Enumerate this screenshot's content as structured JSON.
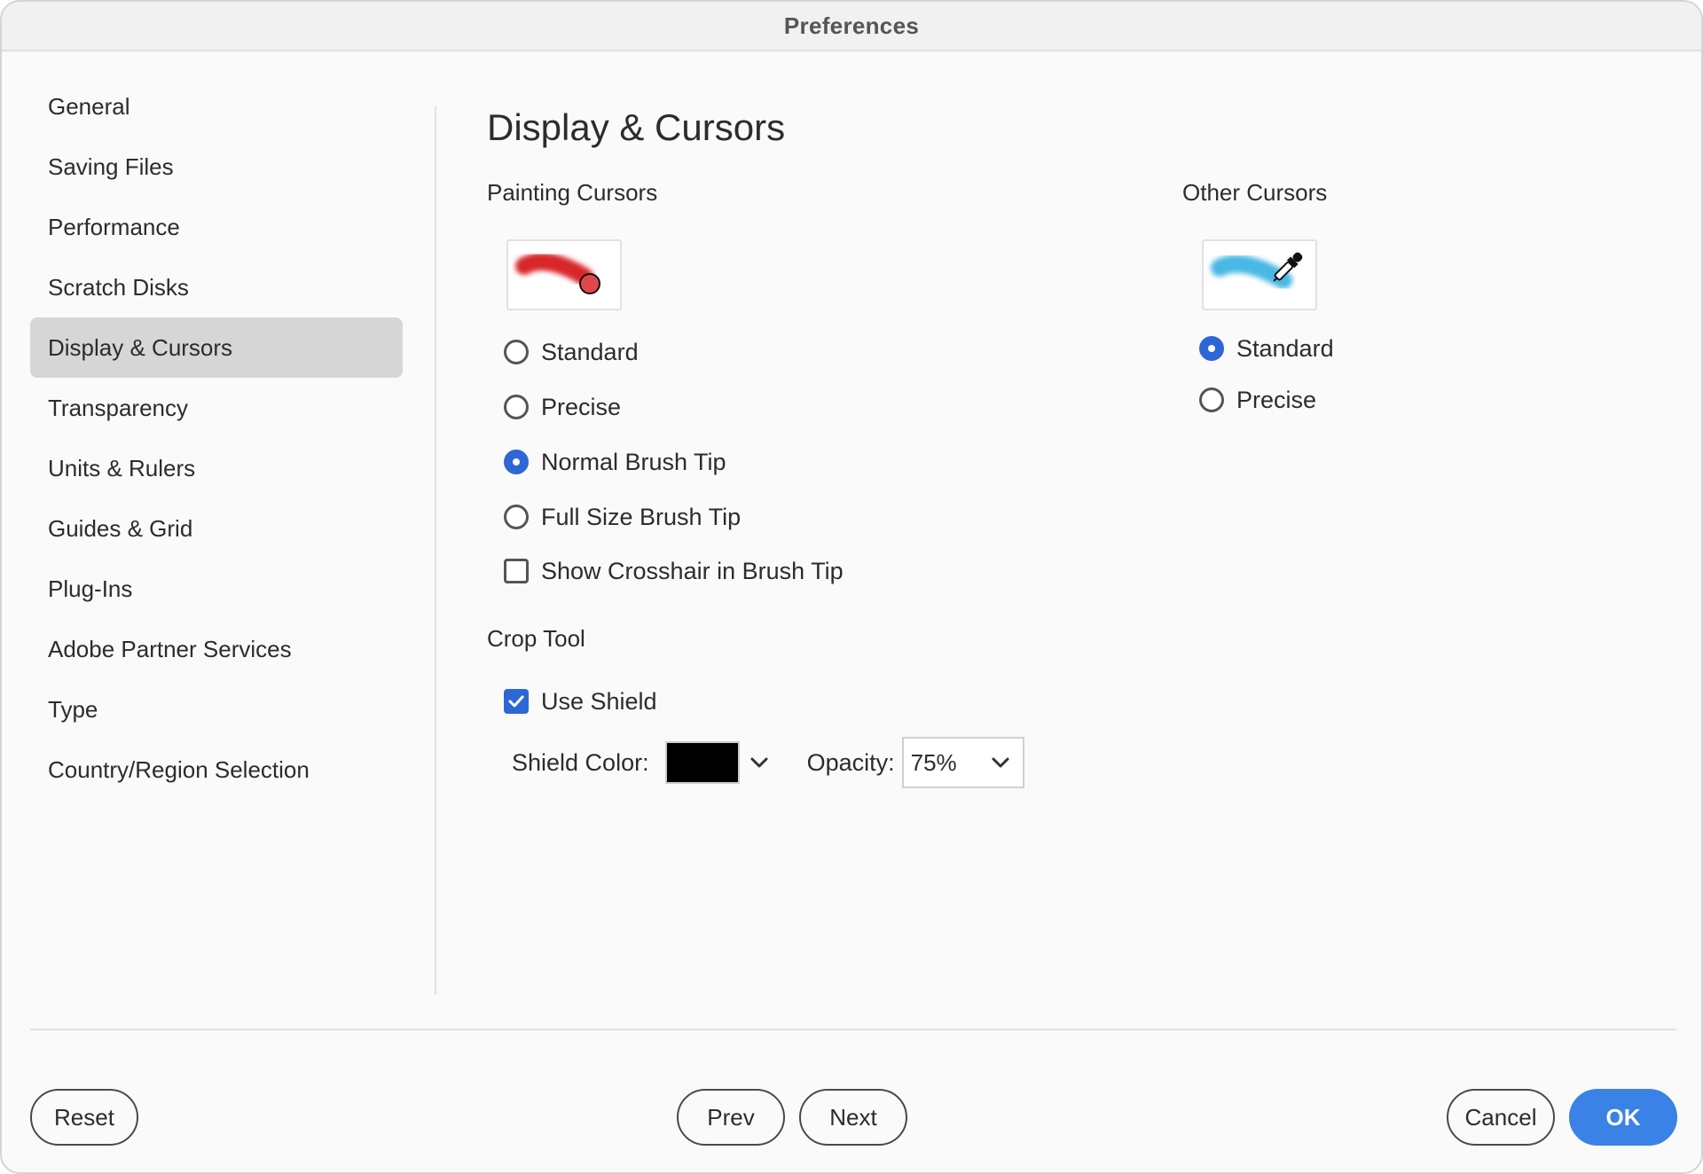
{
  "window": {
    "title": "Preferences"
  },
  "sidebar": {
    "items": [
      {
        "label": "General"
      },
      {
        "label": "Saving Files"
      },
      {
        "label": "Performance"
      },
      {
        "label": "Scratch Disks"
      },
      {
        "label": "Display & Cursors",
        "selected": true
      },
      {
        "label": "Transparency"
      },
      {
        "label": "Units & Rulers"
      },
      {
        "label": "Guides & Grid"
      },
      {
        "label": "Plug-Ins"
      },
      {
        "label": "Adobe Partner Services"
      },
      {
        "label": "Type"
      },
      {
        "label": "Country/Region Selection"
      }
    ]
  },
  "main": {
    "title": "Display & Cursors",
    "painting_cursors": {
      "label": "Painting Cursors",
      "preview_icon": "brush-stroke-red-circle",
      "options": [
        {
          "label": "Standard",
          "checked": false
        },
        {
          "label": "Precise",
          "checked": false
        },
        {
          "label": "Normal Brush Tip",
          "checked": true
        },
        {
          "label": "Full Size Brush Tip",
          "checked": false
        }
      ],
      "crosshair": {
        "label": "Show Crosshair in Brush Tip",
        "checked": false
      }
    },
    "other_cursors": {
      "label": "Other Cursors",
      "preview_icon": "brush-stroke-blue-eyedropper",
      "options": [
        {
          "label": "Standard",
          "checked": true
        },
        {
          "label": "Precise",
          "checked": false
        }
      ]
    },
    "crop_tool": {
      "label": "Crop Tool",
      "use_shield": {
        "label": "Use Shield",
        "checked": true
      },
      "shield_color": {
        "label": "Shield Color:",
        "value": "#000000"
      },
      "opacity": {
        "label": "Opacity:",
        "value": "75%"
      }
    }
  },
  "footer": {
    "reset": "Reset",
    "prev": "Prev",
    "next": "Next",
    "cancel": "Cancel",
    "ok": "OK"
  },
  "colors": {
    "accent": "#2d67d6",
    "ok_button": "#3b82e6",
    "selected_sidebar": "#d6d6d6",
    "painting_stroke": "#d8262c",
    "other_stroke": "#49b8e4"
  }
}
